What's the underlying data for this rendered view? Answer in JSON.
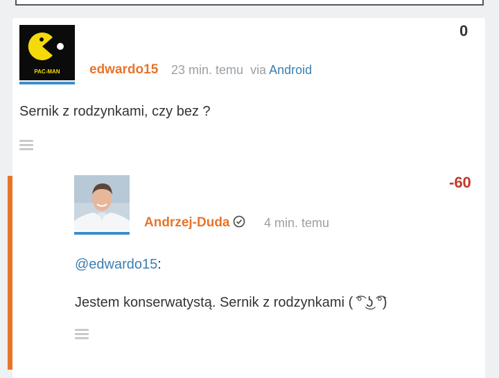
{
  "post": {
    "author": "edwardo15",
    "time": "23 min. temu",
    "via_label": "via",
    "via_app": "Android",
    "score": "0",
    "score_color": "#333333",
    "body": "Sernik z rodzynkami, czy bez ?",
    "avatar_logo_text": "PAC-MAN"
  },
  "reply": {
    "author": "Andrzej-Duda",
    "time": "4 min. temu",
    "score": "-60",
    "score_color": "#c0392b",
    "mention": "@edwardo15",
    "mention_suffix": ":",
    "body": "Jestem konserwatystą. Sernik z rodzynkami ( ͡° ͜ʖ ͡°)"
  },
  "colors": {
    "author": "#e8742a",
    "link": "#3b7fb0",
    "avatar_underline": "#3a8fd0",
    "reply_bar": "#e8742a"
  }
}
